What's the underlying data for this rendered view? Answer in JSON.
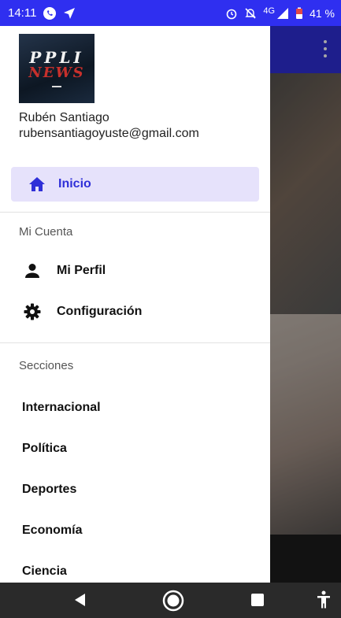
{
  "status": {
    "time": "14:11",
    "network": "4G",
    "battery": "41 %"
  },
  "app_bar": {
    "menu_icon": "more-vert-icon"
  },
  "drawer": {
    "logo": {
      "line1": "PPLI",
      "line2": "NEWS"
    },
    "user_name": "Rubén Santiago",
    "user_email": "rubensantiagoyuste@gmail.com",
    "home": {
      "label": "Inicio",
      "icon": "home-icon"
    },
    "account_section": {
      "title": "Mi Cuenta",
      "items": [
        {
          "label": "Mi Perfil",
          "icon": "person-icon"
        },
        {
          "label": "Configuración",
          "icon": "gear-icon"
        }
      ]
    },
    "sections": {
      "title": "Secciones",
      "items": [
        "Internacional",
        "Política",
        "Deportes",
        "Economía",
        "Ciencia"
      ]
    }
  },
  "colors": {
    "accent": "#2f2fd8",
    "status_bar": "#2f2ff0",
    "active_bg": "#e6e2fb"
  }
}
